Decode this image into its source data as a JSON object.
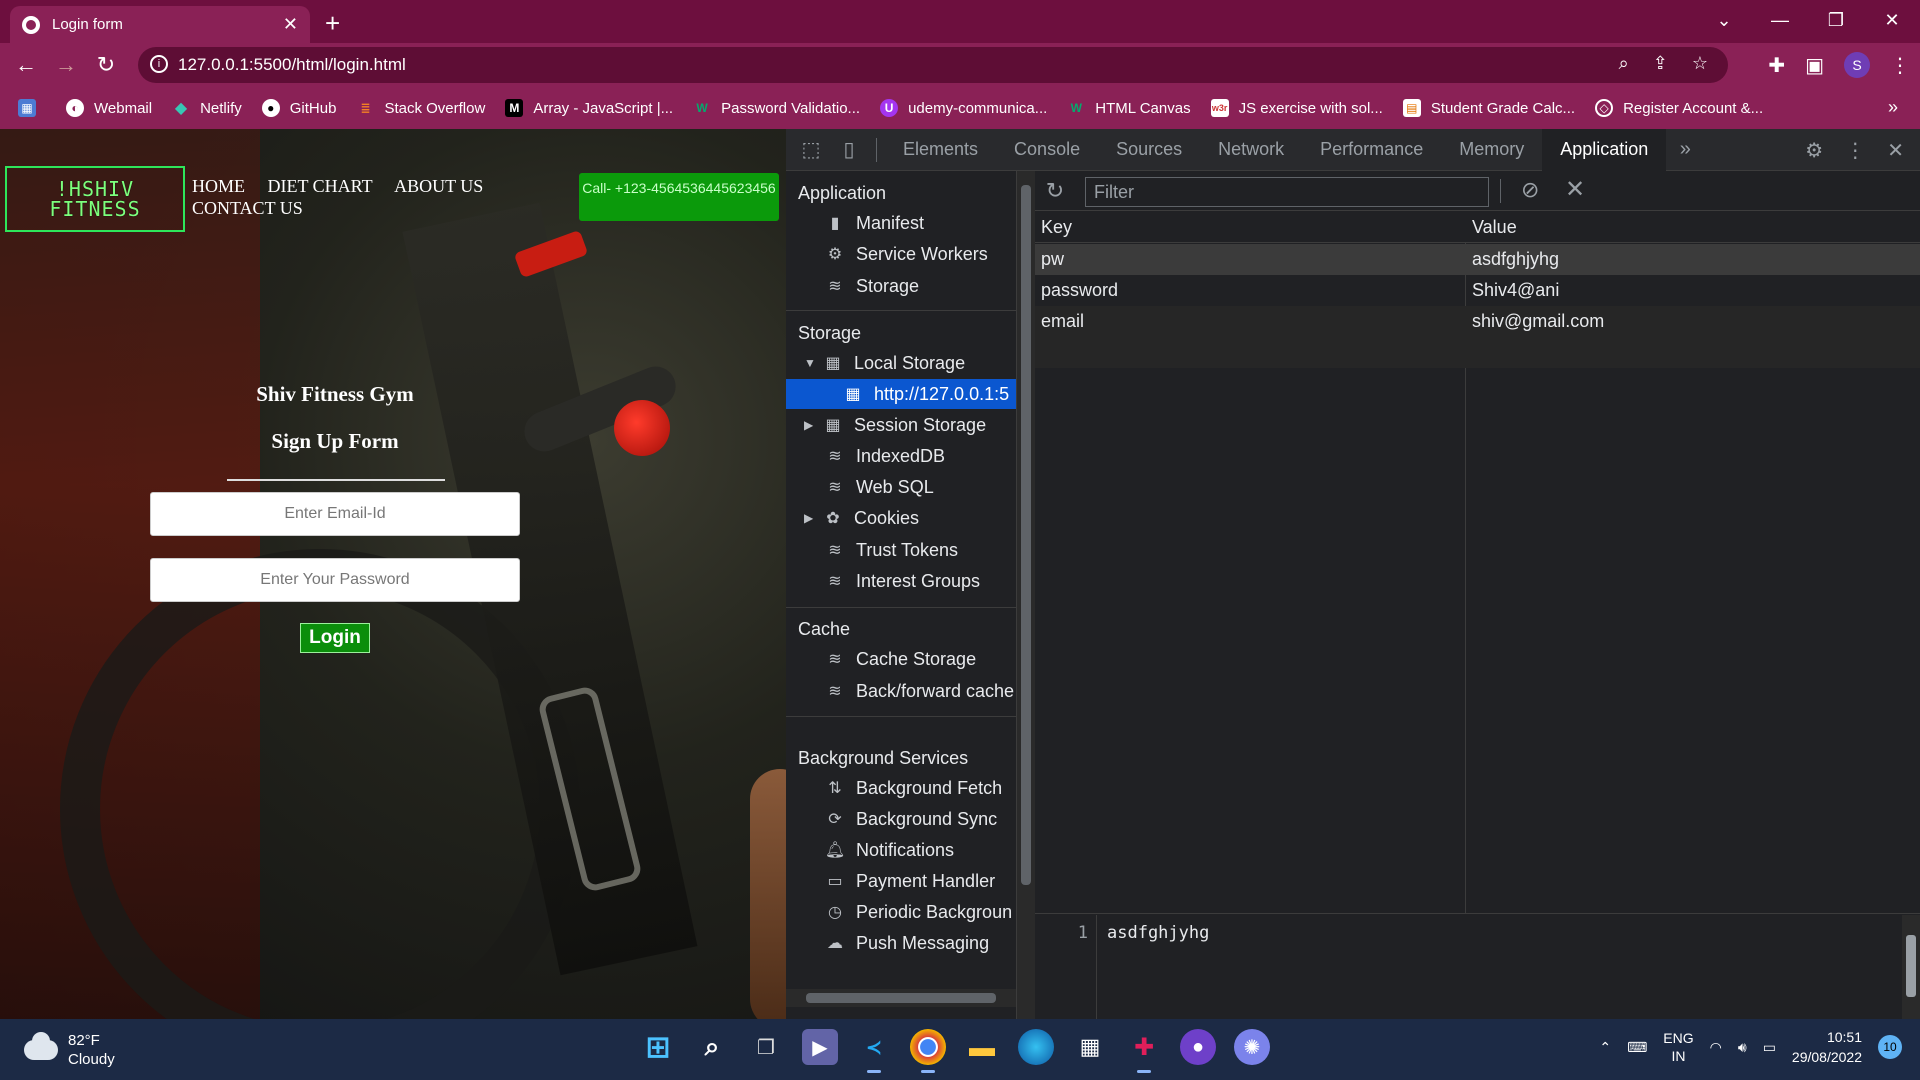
{
  "browser": {
    "tab_title": "Login form",
    "url": "127.0.0.1:5500/html/login.html",
    "profile_initial": "S",
    "bookmarks": [
      {
        "label": "Webmail",
        "icon": "webmail-icon"
      },
      {
        "label": "Netlify",
        "icon": "netlify-icon"
      },
      {
        "label": "GitHub",
        "icon": "github-icon"
      },
      {
        "label": "Stack Overflow",
        "icon": "stackoverflow-icon"
      },
      {
        "label": "Array - JavaScript |...",
        "icon": "mdn-icon"
      },
      {
        "label": "Password Validatio...",
        "icon": "w3-icon"
      },
      {
        "label": "udemy-communica...",
        "icon": "udemy-icon"
      },
      {
        "label": "HTML Canvas",
        "icon": "w3-icon"
      },
      {
        "label": "JS exercise with sol...",
        "icon": "w3r-icon"
      },
      {
        "label": "Student Grade Calc...",
        "icon": "doc-icon"
      },
      {
        "label": "Register Account &...",
        "icon": "codepen-icon"
      }
    ]
  },
  "page": {
    "logo_text": "!HSHIV\nFITNESS",
    "nav": [
      "HOME",
      "DIET CHART",
      "ABOUT US",
      "CONTACT US"
    ],
    "call_button": "Call- +123-4564536445623456",
    "gym_name": "Shiv Fitness Gym",
    "form_title": "Sign Up Form",
    "email_placeholder": "Enter Email-Id",
    "password_placeholder": "Enter Your Password",
    "login_label": "Login"
  },
  "devtools": {
    "tabs": [
      "Elements",
      "Console",
      "Sources",
      "Network",
      "Performance",
      "Memory",
      "Application"
    ],
    "active_tab": "Application",
    "sections": {
      "application": {
        "title": "Application",
        "items": [
          "Manifest",
          "Service Workers",
          "Storage"
        ]
      },
      "storage": {
        "title": "Storage",
        "local_storage": "Local Storage",
        "local_origin": "http://127.0.0.1:5",
        "items": [
          "Session Storage",
          "IndexedDB",
          "Web SQL",
          "Cookies",
          "Trust Tokens",
          "Interest Groups"
        ]
      },
      "cache": {
        "title": "Cache",
        "items": [
          "Cache Storage",
          "Back/forward cache"
        ]
      },
      "background": {
        "title": "Background Services",
        "items": [
          "Background Fetch",
          "Background Sync",
          "Notifications",
          "Payment Handler",
          "Periodic Backgroun",
          "Push Messaging"
        ]
      }
    },
    "filter_placeholder": "Filter",
    "table": {
      "headers": [
        "Key",
        "Value"
      ],
      "rows": [
        {
          "key": "pw",
          "value": "asdfghjyhg"
        },
        {
          "key": "password",
          "value": "Shiv4@ani"
        },
        {
          "key": "email",
          "value": "shiv@gmail.com"
        }
      ]
    },
    "preview": {
      "line_number": "1",
      "content": "asdfghjyhg"
    }
  },
  "taskbar": {
    "temperature": "82°F",
    "condition": "Cloudy",
    "lang_top": "ENG",
    "lang_bottom": "IN",
    "time": "10:51",
    "date": "29/08/2022",
    "notifications": "10"
  }
}
